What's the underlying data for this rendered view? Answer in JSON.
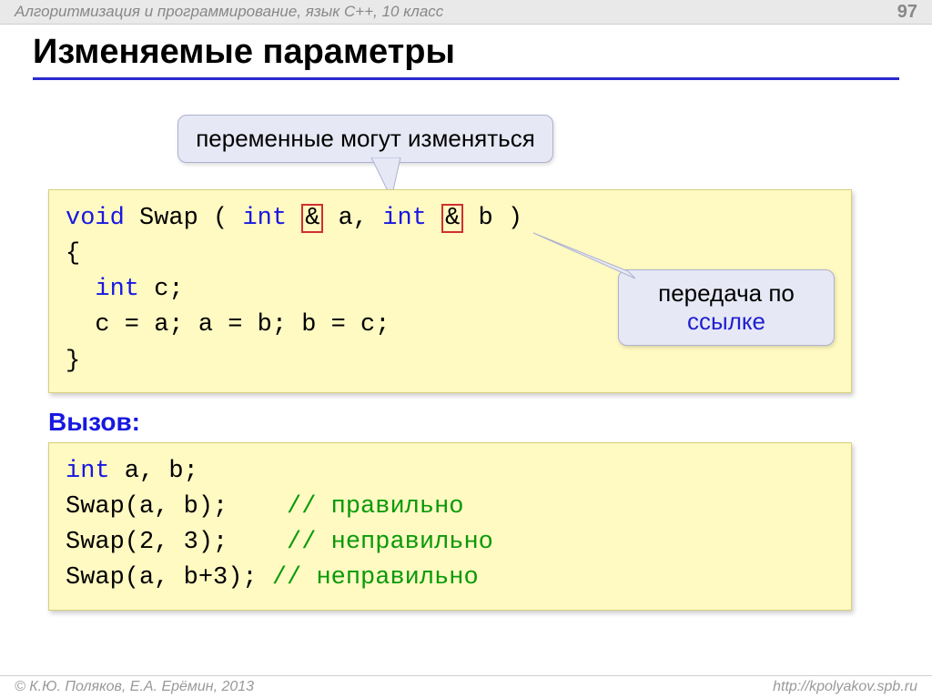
{
  "topbar": {
    "course": "Алгоритмизация и программирование, язык  C++, 10 класс",
    "page": "97"
  },
  "title": "Изменяемые параметры",
  "callouts": {
    "top_note": "переменные могут изменяться",
    "ref_line1": "передача по",
    "ref_word": "ссылке"
  },
  "code1": {
    "void": "void",
    "swap_open": " Swap ( ",
    "int1": "int",
    "sp1": " ",
    "amp1": "&",
    "a_part": " a, ",
    "int2": "int",
    "sp2": " ",
    "amp2": "&",
    "b_close": " b )",
    "brace_open": "{",
    "int_c_kw": "int",
    "int_c_rest": " c;",
    "body": "  c = a; a = b; b = c;",
    "brace_close": "}"
  },
  "call_label": "Вызов:",
  "code2": {
    "int_kw": "int",
    "decl_rest": " a, b;",
    "l2a": "Swap(a, b);    ",
    "l2c": "// правильно",
    "l3a": "Swap(2, 3);    ",
    "l3c": "// неправильно",
    "l4a": "Swap(a, b+3); ",
    "l4c": "// неправильно"
  },
  "footer": {
    "left": "© К.Ю. Поляков, Е.А. Ерёмин, 2013",
    "right": "http://kpolyakov.spb.ru"
  }
}
